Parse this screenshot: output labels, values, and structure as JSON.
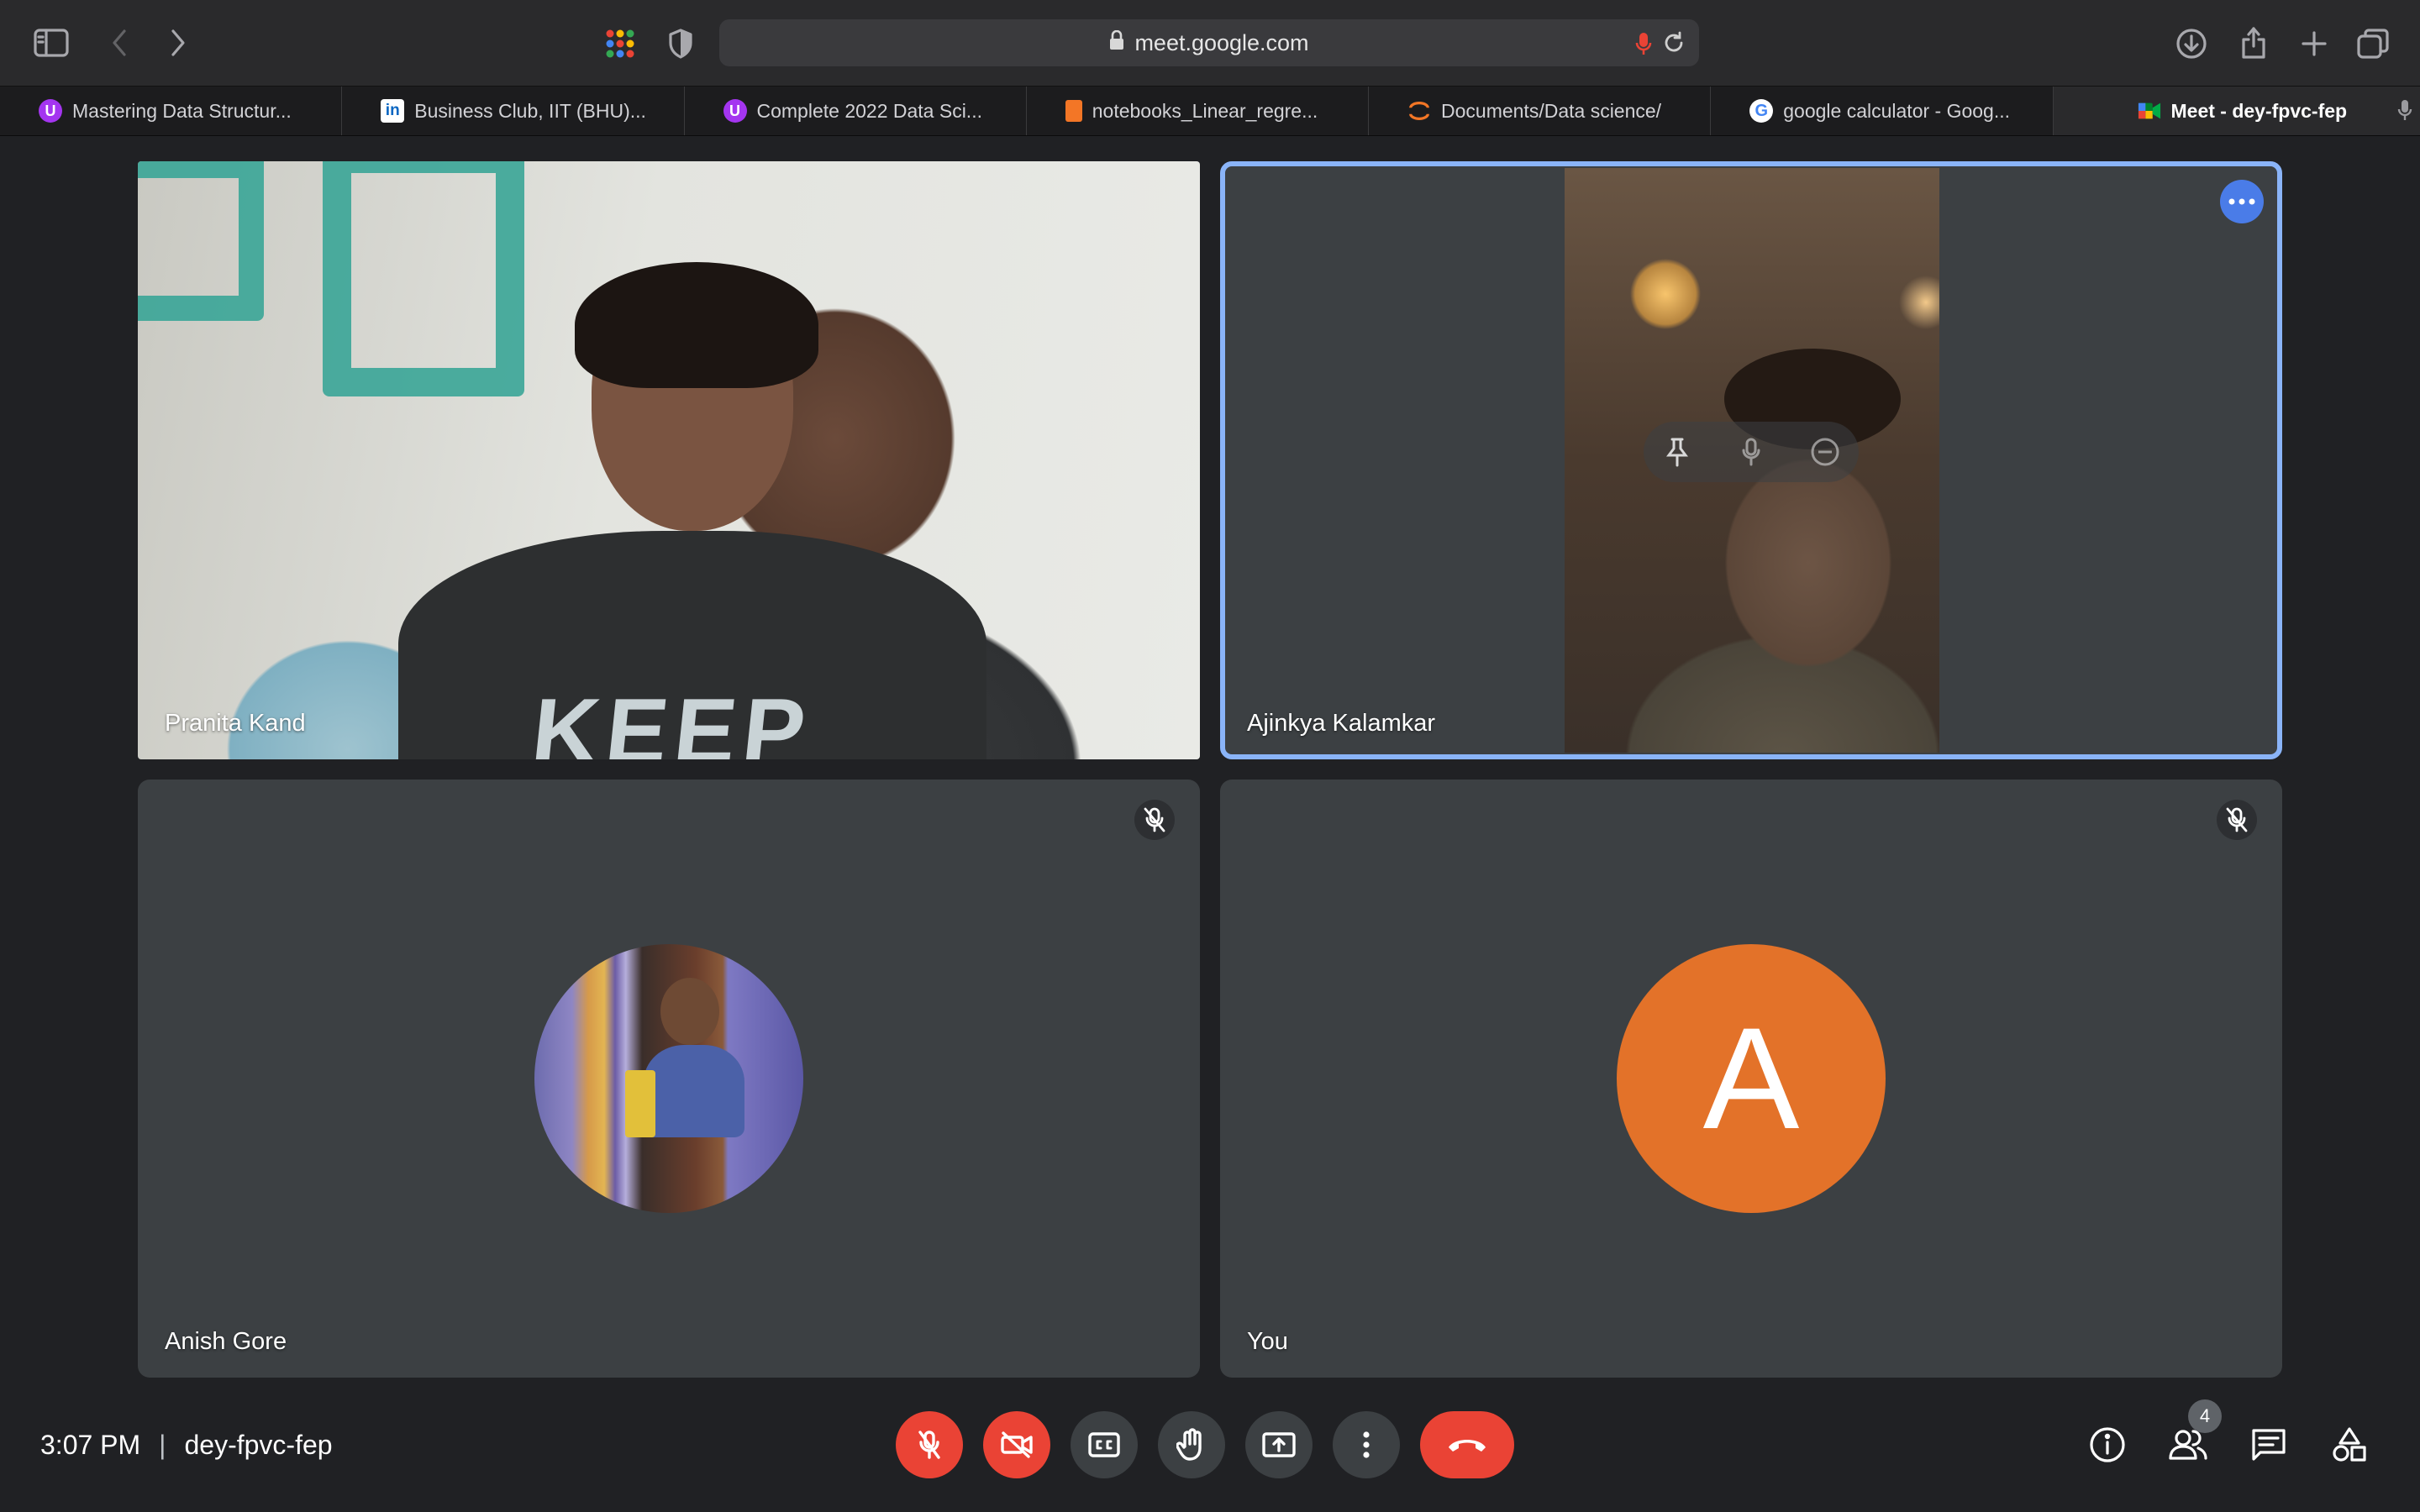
{
  "browser": {
    "url": "meet.google.com",
    "tabs": [
      {
        "label": "Mastering Data Structur...",
        "icon": "udemy-icon",
        "color": "#a435f0"
      },
      {
        "label": "Business Club, IIT (BHU)...",
        "icon": "linkedin-icon",
        "color": "#0a66c2"
      },
      {
        "label": "Complete 2022 Data Sci...",
        "icon": "udemy-icon",
        "color": "#a435f0"
      },
      {
        "label": "notebooks_Linear_regre...",
        "icon": "notebook-icon",
        "color": "#f37626"
      },
      {
        "label": "Documents/Data science/",
        "icon": "jupyter-icon",
        "color": "#f37626"
      },
      {
        "label": "google calculator - Goog...",
        "icon": "google-icon",
        "color": "#4285f4"
      },
      {
        "label": "Meet - dey-fpvc-fep",
        "icon": "meet-icon",
        "color": "#00832d",
        "active": true
      }
    ]
  },
  "participants": [
    {
      "name": "Pranita Kand",
      "video": true,
      "speaking": false
    },
    {
      "name": "Ajinkya Kalamkar",
      "video": true,
      "speaking": true
    },
    {
      "name": "Anish Gore",
      "video": false,
      "muted": true
    },
    {
      "name": "You",
      "video": false,
      "muted": true,
      "avatar_letter": "A",
      "avatar_color": "#e37229"
    }
  ],
  "meeting": {
    "time": "3:07 PM",
    "separator": "|",
    "code": "dey-fpvc-fep",
    "participant_count": "4"
  },
  "colors": {
    "accent_blue": "#8ab4f8",
    "danger_red": "#ea4335",
    "panel": "#3c4043",
    "background": "#202124"
  }
}
